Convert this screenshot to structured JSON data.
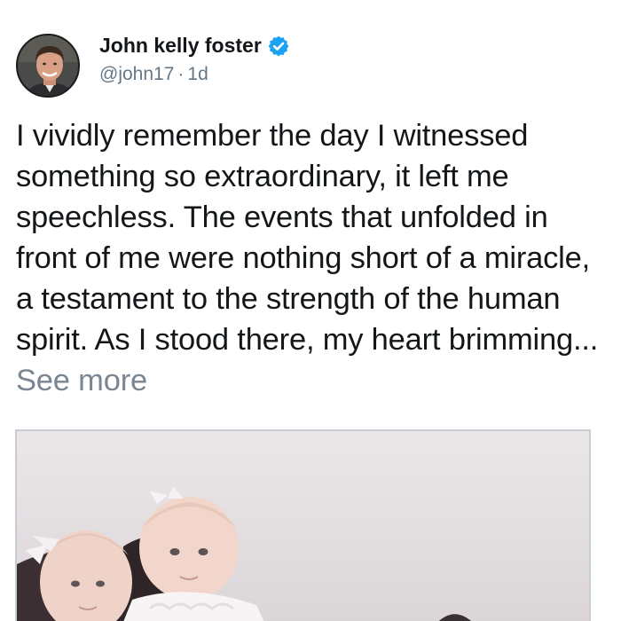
{
  "post": {
    "author": {
      "name": "John kelly foster",
      "handle": "@john17",
      "time": "1d",
      "verified": true,
      "verified_color": "#1da1f2"
    },
    "text": "I vividly remember the day I witnessed something so extraordinary, it left me speechless. The events that unfolded in front of me were nothing short of a miracle, a testament to the strength of the human spirit. As I stood there, my heart brimming...",
    "see_more": "See more",
    "icons": {
      "verified": "verified-badge-icon"
    },
    "colors": {
      "text": "#14171a",
      "secondary": "#657786",
      "see_more": "#7a8691"
    }
  }
}
